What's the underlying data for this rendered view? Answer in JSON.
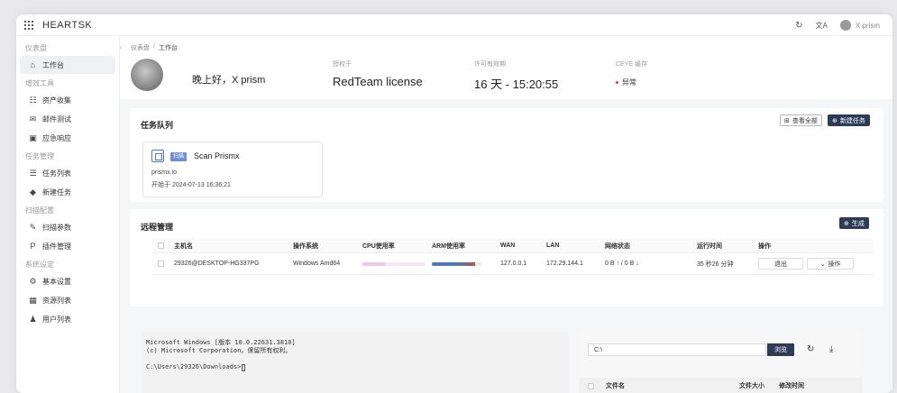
{
  "app": {
    "brand": "HEARTSK",
    "user": "X prism"
  },
  "sidebar": {
    "groups": [
      {
        "title": "仪表盘",
        "items": [
          {
            "label": "工作台",
            "icon": "home-icon",
            "active": true
          }
        ]
      },
      {
        "title": "增效工具",
        "items": [
          {
            "label": "资产收集",
            "icon": "scan-icon"
          },
          {
            "label": "邮件测试",
            "icon": "mail-icon"
          },
          {
            "label": "应急响应",
            "icon": "alert-icon"
          }
        ]
      },
      {
        "title": "任务管理",
        "items": [
          {
            "label": "任务列表",
            "icon": "list-icon"
          },
          {
            "label": "新建任务",
            "icon": "new-task-icon"
          }
        ]
      },
      {
        "title": "扫描配置",
        "items": [
          {
            "label": "扫描参数",
            "icon": "edit-icon"
          },
          {
            "label": "插件管理",
            "icon": "plugin-icon"
          }
        ]
      },
      {
        "title": "系统设定",
        "items": [
          {
            "label": "基本设置",
            "icon": "gear-icon"
          },
          {
            "label": "资源列表",
            "icon": "resource-icon"
          },
          {
            "label": "用户列表",
            "icon": "users-icon"
          }
        ]
      }
    ]
  },
  "header": {
    "breadcrumb": [
      "仪表盘",
      "工作台"
    ],
    "greeting": "晚上好，X prism",
    "stats": {
      "license_label": "授权于",
      "license_value": "RedTeam license",
      "remaining_label": "许可有效期",
      "remaining_value": "16 天 - 15:20:55",
      "ceye_label": "CEYE 缓存",
      "ceye_value": "异常"
    }
  },
  "tasks": {
    "title": "任务队列",
    "view_all": "查看全部",
    "new_task": "新建任务",
    "items": [
      {
        "badge": "扫描",
        "name": "Scan Prismx",
        "host": "prismx.io",
        "started": "开始于 2024-07-13 16:36:21"
      }
    ]
  },
  "remote": {
    "title": "远程管理",
    "generate": "生成",
    "columns": [
      "主机名",
      "操作系统",
      "CPU使用率",
      "ARM使用率",
      "WAN",
      "LAN",
      "网络状态",
      "运行时间",
      "操作"
    ],
    "rows": [
      {
        "hostname": "29326@DESKTOP-HG337PG",
        "os": "Windows Amd64",
        "cpu": 0.35,
        "arm": 0.88,
        "wan": "127.0.0.1",
        "lan": "172.29.144.1",
        "net": "0 B ↑ / 0 B ↓",
        "uptime": "35 秒26 分钟",
        "exit": "退出",
        "ops": "操作"
      }
    ]
  },
  "terminal": {
    "lines": [
      "Microsoft Windows [版本 10.0.22631.3810]",
      "(c) Microsoft Corporation。保留所有权利。"
    ],
    "prompt": "C:\\Users\\29326\\Downloads>"
  },
  "files": {
    "path": "C:\\",
    "browse": "浏览",
    "columns": [
      "文件名",
      "文件大小",
      "修改时间"
    ]
  },
  "colors": {
    "accent": "#2d3b57",
    "badge": "#6f8fd6",
    "cpu_bar": "#f1c6e8",
    "arm_bar_a": "#4a78c2",
    "arm_bar_b": "#c0504d",
    "status_dot": "#e53935"
  }
}
